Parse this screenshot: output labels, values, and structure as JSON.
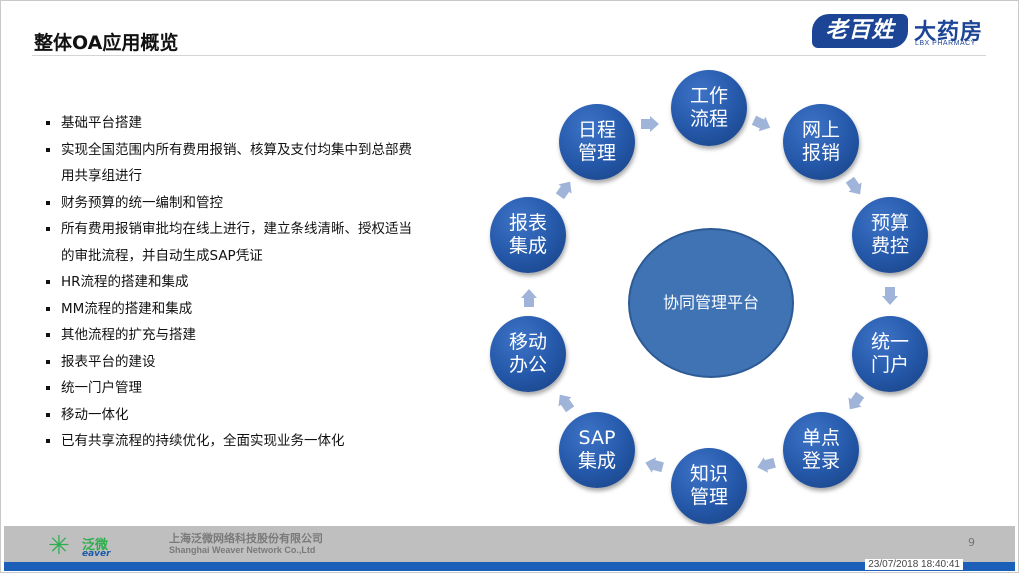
{
  "slide": {
    "title": "整体OA应用概览",
    "page_number": "9",
    "timestamp": "23/07/2018 18:40:41"
  },
  "logo": {
    "badge": "老百姓",
    "name_cn": "大药房",
    "name_en": "LBX PHARMACY"
  },
  "bullets": [
    "基础平台搭建",
    "实现全国范围内所有费用报销、核算及支付均集中到总部费用共享组进行",
    "财务预算的统一编制和管控",
    "所有费用报销审批均在线上进行，建立条线清晰、授权适当的审批流程，并自动生成SAP凭证",
    "HR流程的搭建和集成",
    "MM流程的搭建和集成",
    "其他流程的扩充与搭建",
    "报表平台的建设",
    "统一门户管理",
    "移动一体化",
    "已有共享流程的持续优化，全面实现业务一体化"
  ],
  "diagram": {
    "center": "协同管理平台",
    "nodes": [
      {
        "id": "work-flow",
        "label": "工作\n流程"
      },
      {
        "id": "online-reimburse",
        "label": "网上\n报销"
      },
      {
        "id": "budget-control",
        "label": "预算\n费控"
      },
      {
        "id": "unified-portal",
        "label": "统一\n门户"
      },
      {
        "id": "single-signon",
        "label": "单点\n登录"
      },
      {
        "id": "knowledge-mgmt",
        "label": "知识\n管理"
      },
      {
        "id": "sap-integration",
        "label": "SAP\n集成"
      },
      {
        "id": "mobile-office",
        "label": "移动\n办公"
      },
      {
        "id": "report-integration",
        "label": "报表\n集成"
      },
      {
        "id": "schedule-mgmt",
        "label": "日程\n管理"
      }
    ]
  },
  "footer": {
    "logo_cn": "泛微",
    "logo_en": "eaver",
    "company_cn": "上海泛微网络科技股份有限公司",
    "company_en": "Shanghai Weaver Network  Co.,Ltd"
  },
  "colors": {
    "node_blue": "#2457a8",
    "center_blue": "#3f73b4",
    "arrow_blue": "#9fb4d8",
    "footer_bar": "#1b5fb8",
    "footer_gray": "#bfbfbf"
  }
}
